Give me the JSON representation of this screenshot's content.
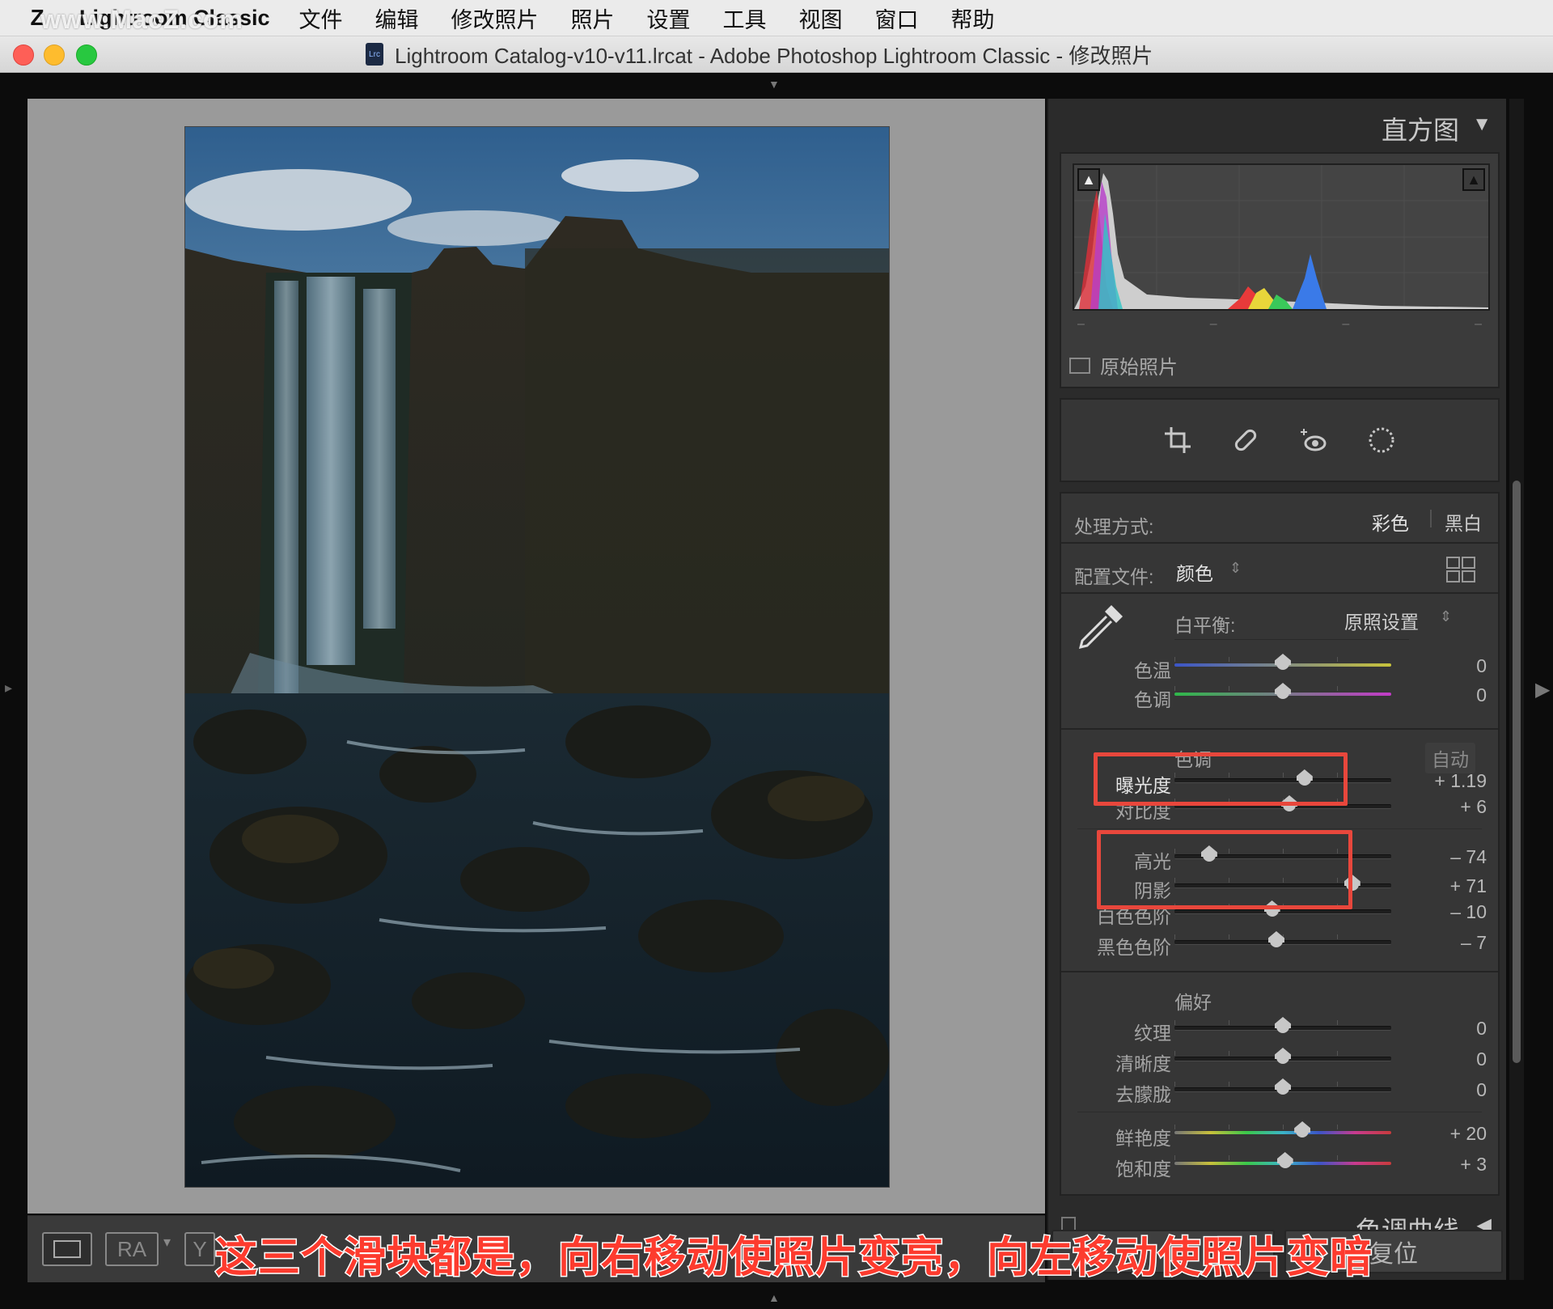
{
  "menubar": {
    "app_name": "Lightroom Classic",
    "items": [
      "文件",
      "编辑",
      "修改照片",
      "照片",
      "设置",
      "工具",
      "视图",
      "窗口",
      "帮助"
    ],
    "watermark": "www.MacZ.com"
  },
  "window": {
    "title": "Lightroom Catalog-v10-v11.lrcat - Adobe Photoshop Lightroom Classic - 修改照片",
    "doc_icon": "Lrc"
  },
  "toolbar": {
    "ra_label": "RA",
    "y_label": "Y"
  },
  "histogram": {
    "title": "直方图",
    "original_photo_label": "原始照片"
  },
  "basic": {
    "treatment_label": "处理方式:",
    "treatment_color": "彩色",
    "treatment_bw": "黑白",
    "profile_label": "配置文件:",
    "profile_value": "颜色",
    "wb_label": "白平衡:",
    "wb_value": "原照设置",
    "tone_header": "色调",
    "auto_label": "自动",
    "presence_header": "偏好",
    "sliders": {
      "temp": {
        "label": "色温",
        "value": "0",
        "level": 0.5
      },
      "tint": {
        "label": "色调",
        "value": "0",
        "level": 0.5
      },
      "exposure": {
        "label": "曝光度",
        "value": "+ 1.19",
        "level": 0.6
      },
      "contrast": {
        "label": "对比度",
        "value": "+ 6",
        "level": 0.53
      },
      "highlights": {
        "label": "高光",
        "value": "– 74",
        "level": 0.16
      },
      "shadows": {
        "label": "阴影",
        "value": "+ 71",
        "level": 0.82
      },
      "whites": {
        "label": "白色色阶",
        "value": "– 10",
        "level": 0.45
      },
      "blacks": {
        "label": "黑色色阶",
        "value": "– 7",
        "level": 0.47
      },
      "texture": {
        "label": "纹理",
        "value": "0",
        "level": 0.5
      },
      "clarity": {
        "label": "清晰度",
        "value": "0",
        "level": 0.5
      },
      "dehaze": {
        "label": "去朦胧",
        "value": "0",
        "level": 0.5
      },
      "vibrance": {
        "label": "鲜艳度",
        "value": "+ 20",
        "level": 0.59
      },
      "saturation": {
        "label": "饱和度",
        "value": "+ 3",
        "level": 0.51
      }
    }
  },
  "tone_curve": {
    "title": "色调曲线"
  },
  "buttons": {
    "reset": "复位"
  },
  "caption": "这三个滑块都是，向右移动使照片变亮，向左移动使照片变暗",
  "colors": {
    "annotation_red": "#e8473c",
    "caption_red": "#fd3b2e"
  }
}
